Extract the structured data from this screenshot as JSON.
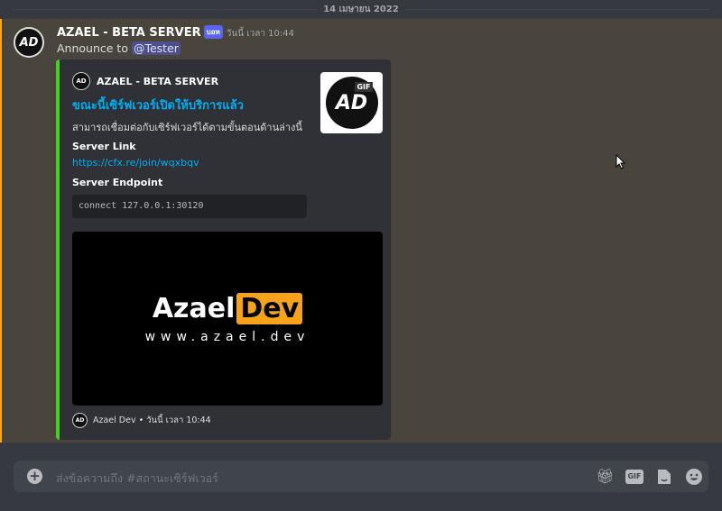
{
  "date_divider": "14 เมษายน 2022",
  "message": {
    "author": "AZAEL - BETA SERVER",
    "bot_badge": "บอท",
    "timestamp": "วันนี้ เวลา 10:44",
    "text": "Announce to",
    "mention": "@Tester",
    "avatar_text": "AD",
    "embed": {
      "author": "AZAEL - BETA SERVER",
      "title": "ขณะนี้เซิร์ฟเวอร์เปิดให้บริการแล้ว",
      "description": "สามารถเชื่อมต่อกับเซิร์ฟเวอร์ได้ตามขั้นตอนด้านล่างนี้",
      "fields": [
        {
          "name": "Server Link",
          "value": "https://cfx.re/join/wqxbqv"
        },
        {
          "name": "Server Endpoint",
          "value": "connect 127.0.0.1:30120"
        }
      ],
      "thumbnail_badge": "GIF",
      "image": {
        "logo_left": "Azael",
        "logo_right": "Dev",
        "url": "www.azael.dev"
      },
      "footer": "Azael Dev • วันนี้ เวลา 10:44",
      "accent_color": "#43d125"
    }
  },
  "composer": {
    "placeholder": "ส่งข้อความถึง #สถานะเซิร์ฟเวอร์",
    "gif_label": "GIF",
    "icons": [
      "plus-icon",
      "gift-icon",
      "gif-icon",
      "sticker-icon",
      "emoji-icon"
    ]
  }
}
